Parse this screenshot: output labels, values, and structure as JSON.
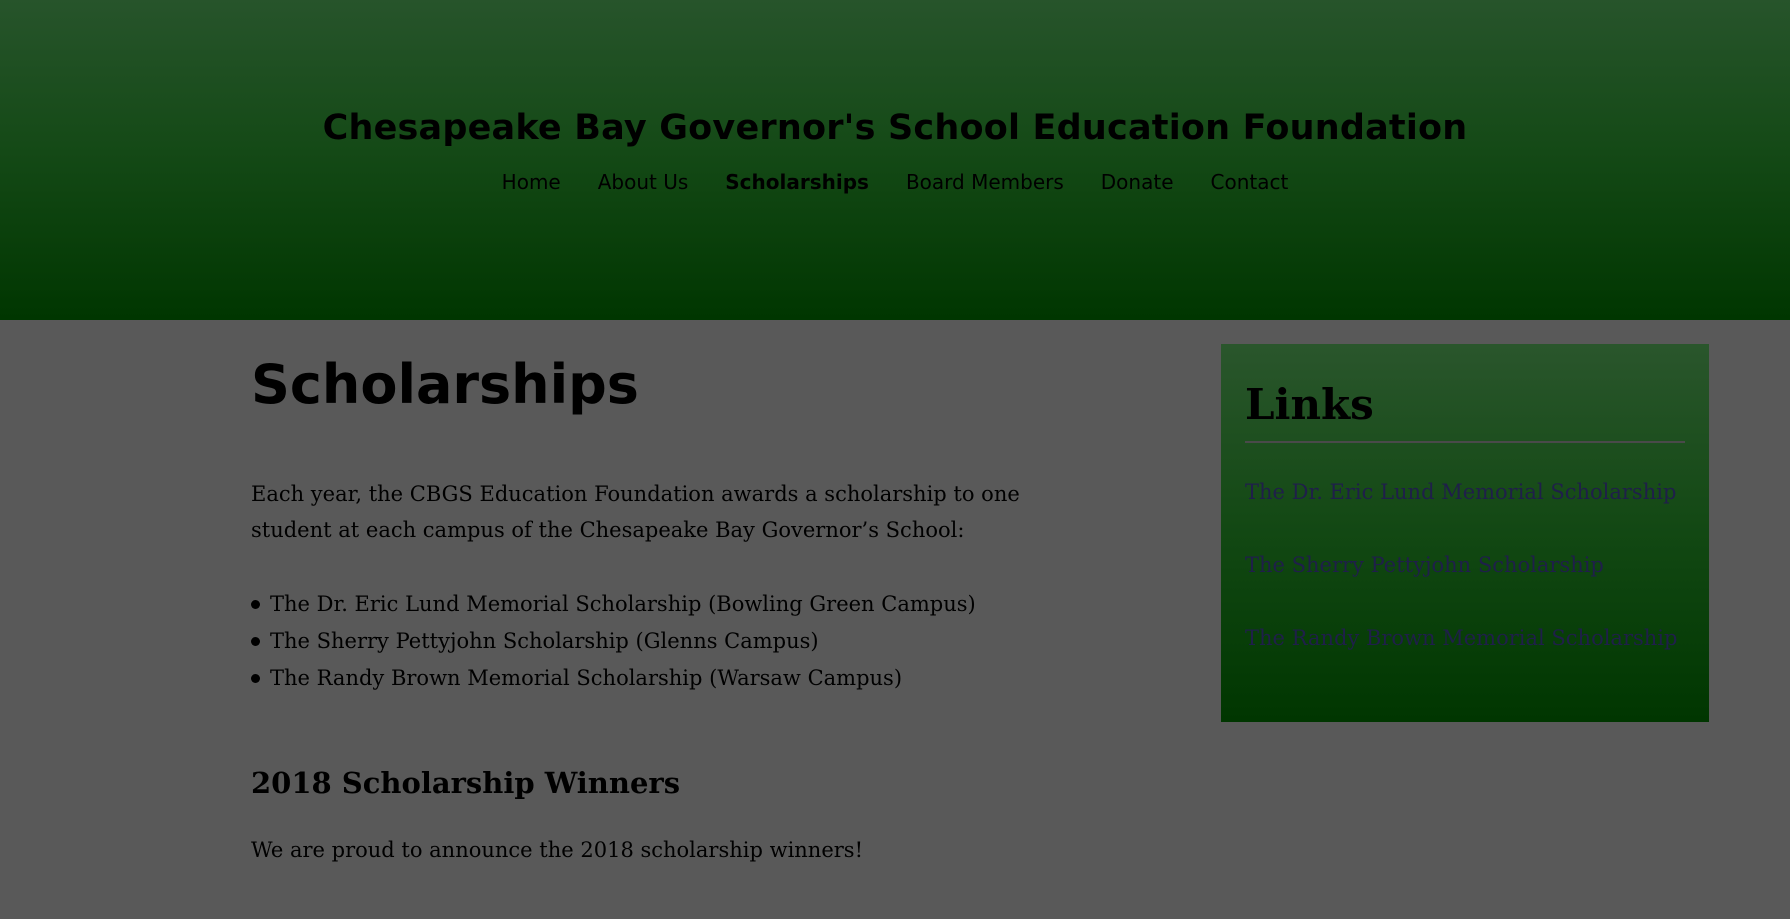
{
  "header": {
    "site_title": "Chesapeake Bay Governor's School Education Foundation",
    "nav": [
      {
        "label": "Home",
        "active": false
      },
      {
        "label": "About Us",
        "active": false
      },
      {
        "label": "Scholarships",
        "active": true
      },
      {
        "label": "Board Members",
        "active": false
      },
      {
        "label": "Donate",
        "active": false
      },
      {
        "label": "Contact",
        "active": false
      }
    ]
  },
  "main": {
    "title": "Scholarships",
    "intro": "Each year, the CBGS Education Foundation awards a scholarship to one student at each campus of the Chesapeake Bay Governor’s School:",
    "scholarships": [
      "The Dr. Eric Lund Memorial Scholarship (Bowling Green Campus)",
      "The Sherry Pettyjohn Scholarship (Glenns Campus)",
      "The Randy Brown Memorial Scholarship (Warsaw Campus)"
    ],
    "winners_heading": "2018 Scholarship Winners",
    "winners_text": "We are proud to announce the 2018 scholarship winners!"
  },
  "sidebar": {
    "title": "Links",
    "links": [
      "The Dr. Eric Lund Memorial Scholarship",
      "The Sherry Pettyjohn Scholarship",
      "The Randy Brown Memorial Scholarship"
    ]
  },
  "colors": {
    "header_top": "#27542b",
    "header_bottom": "#003600",
    "page_background": "#595959",
    "link_color": "#1f1f4a"
  }
}
